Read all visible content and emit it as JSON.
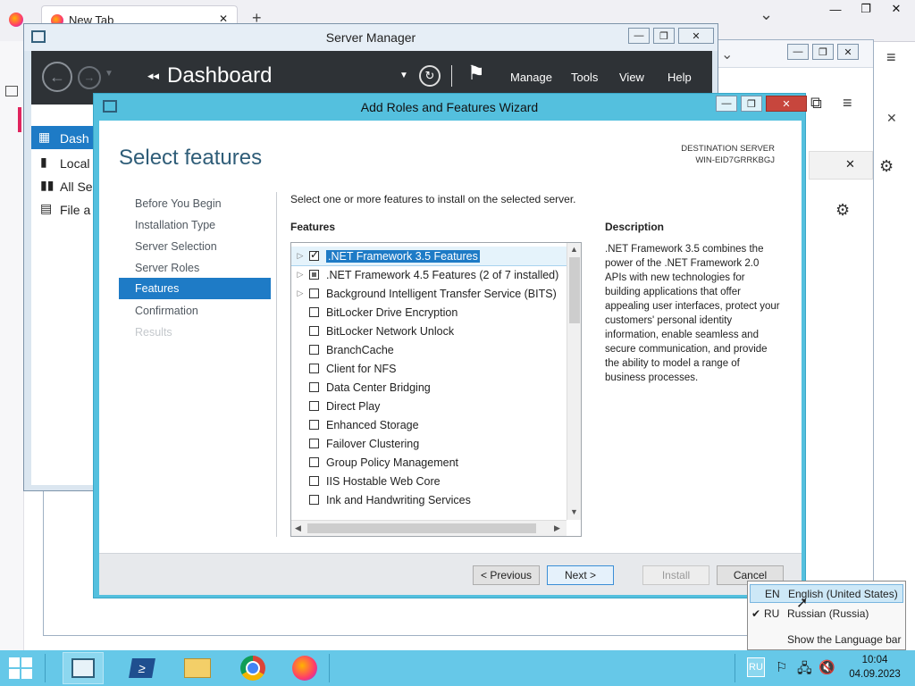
{
  "browser": {
    "tab_title": "New Tab",
    "tab_close": "✕",
    "new_tab": "+",
    "chevron": "⌄",
    "window_controls": {
      "minimize": "—",
      "maximize": "❐",
      "close": "✕"
    }
  },
  "server_manager": {
    "title": "Server Manager",
    "breadcrumb": "Dashboard",
    "menu": [
      "Manage",
      "Tools",
      "View",
      "Help"
    ],
    "sidebar": [
      "Dash",
      "Local",
      "All Se",
      "File a"
    ]
  },
  "wizard": {
    "title": "Add Roles and Features Wizard",
    "heading": "Select features",
    "destination_label": "DESTINATION SERVER",
    "destination_server": "WIN-EID7GRRKBGJ",
    "instruction": "Select one or more features to install on the selected server.",
    "nav": [
      "Before You Begin",
      "Installation Type",
      "Server Selection",
      "Server Roles",
      "Features",
      "Confirmation",
      "Results"
    ],
    "features_header": "Features",
    "features": [
      {
        "label": ".NET Framework 3.5 Features",
        "state": "checked",
        "expand": true
      },
      {
        "label": ".NET Framework 4.5 Features (2 of 7 installed)",
        "state": "partial",
        "expand": true
      },
      {
        "label": "Background Intelligent Transfer Service (BITS)",
        "state": "unchecked",
        "expand": true
      },
      {
        "label": "BitLocker Drive Encryption",
        "state": "unchecked",
        "expand": false
      },
      {
        "label": "BitLocker Network Unlock",
        "state": "unchecked",
        "expand": false
      },
      {
        "label": "BranchCache",
        "state": "unchecked",
        "expand": false
      },
      {
        "label": "Client for NFS",
        "state": "unchecked",
        "expand": false
      },
      {
        "label": "Data Center Bridging",
        "state": "unchecked",
        "expand": false
      },
      {
        "label": "Direct Play",
        "state": "unchecked",
        "expand": false
      },
      {
        "label": "Enhanced Storage",
        "state": "unchecked",
        "expand": false
      },
      {
        "label": "Failover Clustering",
        "state": "unchecked",
        "expand": false
      },
      {
        "label": "Group Policy Management",
        "state": "unchecked",
        "expand": false
      },
      {
        "label": "IIS Hostable Web Core",
        "state": "unchecked",
        "expand": false
      },
      {
        "label": "Ink and Handwriting Services",
        "state": "unchecked",
        "expand": false
      }
    ],
    "description_header": "Description",
    "description_text": ".NET Framework 3.5 combines the power of the .NET Framework 2.0 APIs with new technologies for building applications that offer appealing user interfaces, protect your customers' personal identity information, enable seamless and secure communication, and provide the ability to model a range of business processes.",
    "buttons": {
      "previous": "< Previous",
      "next": "Next >",
      "install": "Install",
      "cancel": "Cancel"
    }
  },
  "language_popup": {
    "items": [
      {
        "code": "EN",
        "name": "English (United States)",
        "checked": false,
        "highlighted": true
      },
      {
        "code": "RU",
        "name": "Russian (Russia)",
        "checked": true,
        "highlighted": false
      }
    ],
    "show_bar": "Show the Language bar"
  },
  "taskbar": {
    "lang_indicator": "RU",
    "time": "10:04",
    "date": "04.09.2023"
  },
  "colors": {
    "taskbar": "#66c8e8",
    "wizard_frame": "#54c0de",
    "nav_selected": "#1e7bc6",
    "close_button": "#c7463d"
  }
}
